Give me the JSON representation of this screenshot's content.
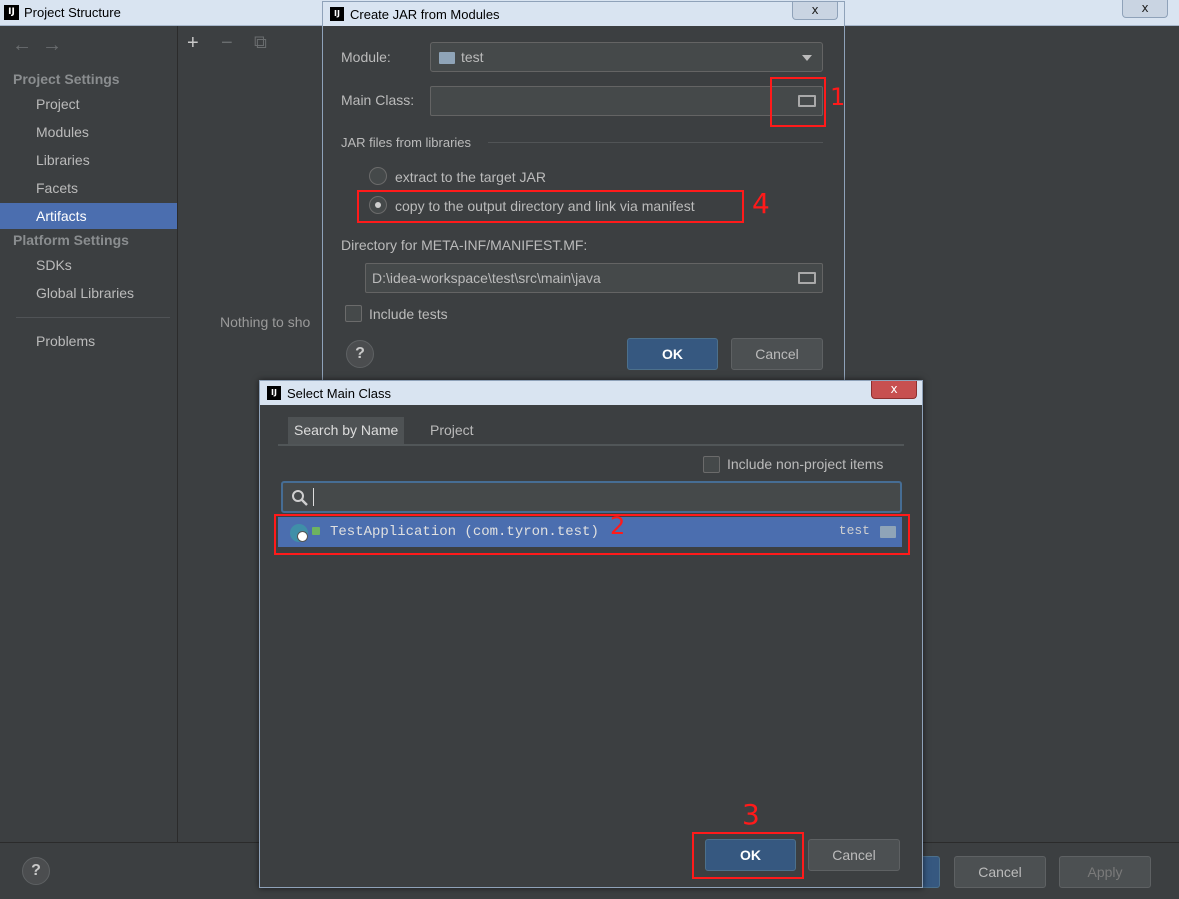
{
  "main_window": {
    "logo": "IJ",
    "title": "Project Structure",
    "close": "x",
    "nav": {
      "back": "←",
      "forward": "→"
    },
    "toolbar": {
      "add": "+",
      "remove": "−",
      "copy": "⧉"
    },
    "sidebar": {
      "section_project": "Project Settings",
      "project_items": [
        {
          "label": "Project"
        },
        {
          "label": "Modules"
        },
        {
          "label": "Libraries"
        },
        {
          "label": "Facets"
        },
        {
          "label": "Artifacts",
          "selected": true
        }
      ],
      "section_platform": "Platform Settings",
      "platform_items": [
        {
          "label": "SDKs"
        },
        {
          "label": "Global Libraries"
        }
      ],
      "problems": "Problems"
    },
    "content_placeholder": "Nothing to sho",
    "footer": {
      "help": "?",
      "ok": "OK",
      "cancel": "Cancel",
      "apply": "Apply"
    }
  },
  "create_jar_dialog": {
    "logo": "IJ",
    "title": "Create JAR from Modules",
    "close": "x",
    "module_label": "Module:",
    "module_value": "test",
    "main_class_label": "Main Class:",
    "main_class_value": "",
    "jar_files_section": "JAR files from libraries",
    "radio_extract": "extract to the target JAR",
    "radio_copy": "copy to the output directory and link via manifest",
    "radio_selected": "copy",
    "manifest_dir_label": "Directory for META-INF/MANIFEST.MF:",
    "manifest_dir_value": "D:\\idea-workspace\\test\\src\\main\\java",
    "include_tests_label": "Include tests",
    "include_tests_checked": false,
    "help": "?",
    "ok": "OK",
    "cancel": "Cancel"
  },
  "select_main_class_dialog": {
    "logo": "IJ",
    "title": "Select Main Class",
    "close": "x",
    "tabs": [
      {
        "label": "Search by Name",
        "selected": true
      },
      {
        "label": "Project",
        "selected": false
      }
    ],
    "include_non_project_label": "Include non-project items",
    "include_non_project_checked": false,
    "search_icon": "search-icon",
    "search_value": "",
    "results": [
      {
        "text": "TestApplication (com.tyron.test)",
        "module": "test",
        "selected": true
      }
    ],
    "ok": "OK",
    "cancel": "Cancel"
  },
  "annotations": [
    "1",
    "2",
    "3",
    "4"
  ],
  "colors": {
    "background": "#3c3f41",
    "selection": "#4b6eaf",
    "primary_button": "#365880",
    "annotation_red": "#ff1a1a",
    "title_bar": "#d9e4f1"
  }
}
